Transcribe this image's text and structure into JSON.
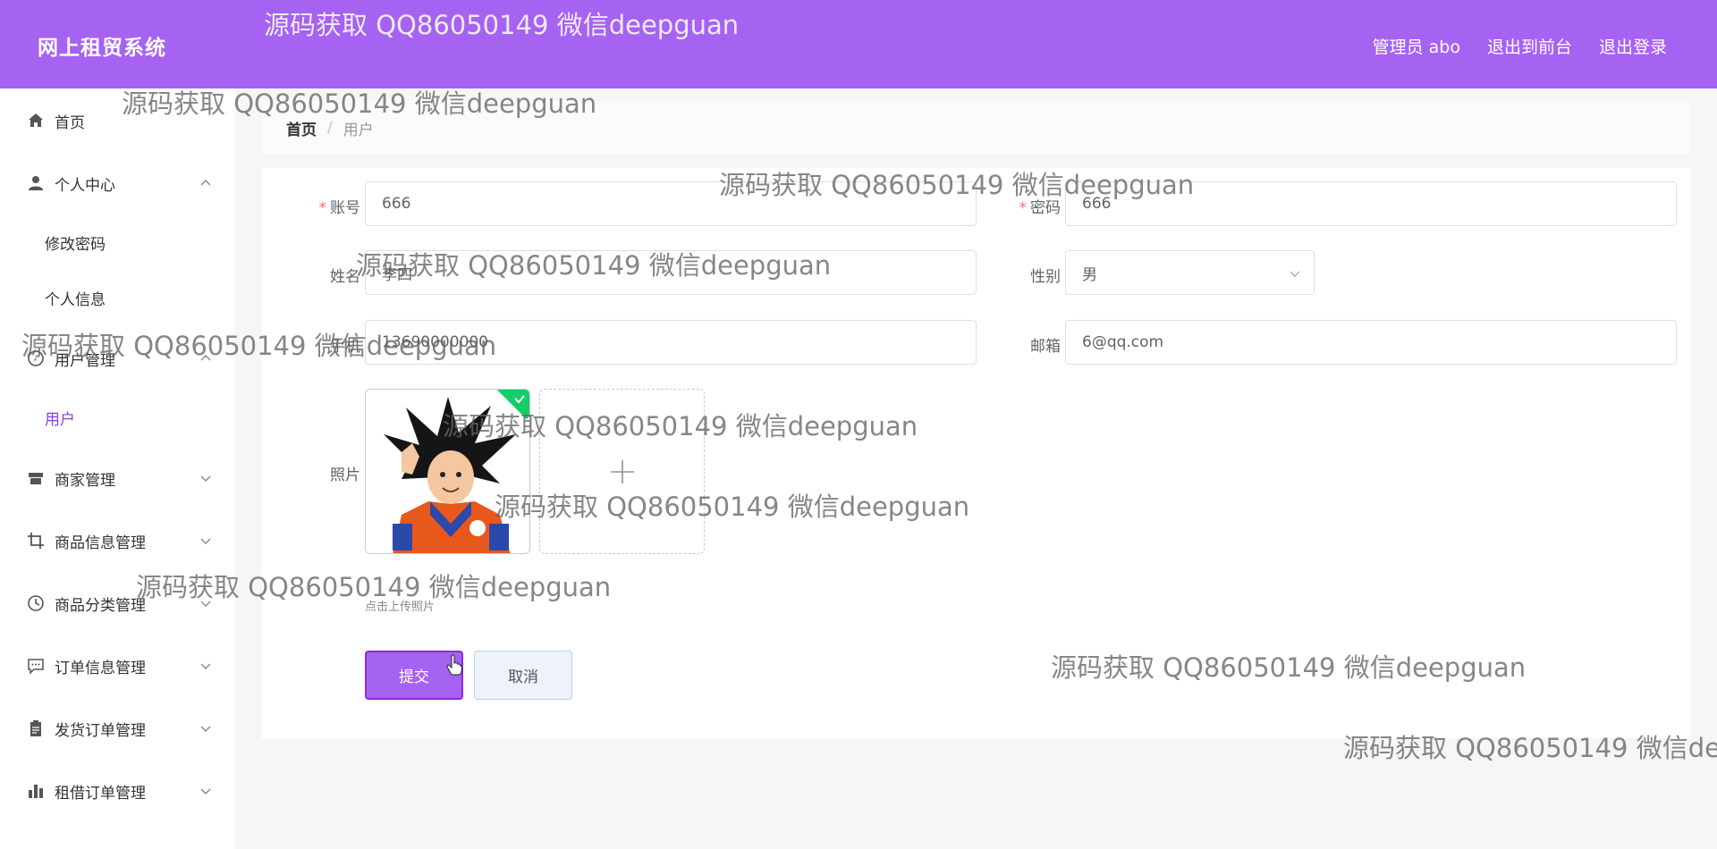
{
  "header": {
    "brand": "网上租贸系统",
    "links": [
      "管理员 abo",
      "退出到前台",
      "退出登录"
    ]
  },
  "sidebar": {
    "home": "首页",
    "personal_center": "个人中心",
    "change_password": "修改密码",
    "personal_info": "个人信息",
    "user_mgmt": "用户管理",
    "user": "用户",
    "merchant_mgmt": "商家管理",
    "product_info_mgmt": "商品信息管理",
    "category_mgmt": "商品分类管理",
    "order_info_mgmt": "订单信息管理",
    "shipping_order_mgmt": "发货订单管理",
    "rental_order_mgmt": "租借订单管理"
  },
  "breadcrumb": {
    "home": "首页",
    "sep": "/",
    "current": "用户"
  },
  "form": {
    "account_label": "账号",
    "account_value": "666",
    "password_label": "密码",
    "password_value": "666",
    "name_label": "姓名",
    "name_value": "李四",
    "gender_label": "性别",
    "gender_value": "男",
    "phone_label": "手机",
    "phone_value": "13690000000",
    "email_label": "邮箱",
    "email_value": "6@qq.com",
    "photo_label": "照片",
    "upload_tip": "点击上传照片",
    "submit": "提交",
    "cancel": "取消"
  },
  "watermark": "源码获取 QQ86050149 微信deepguan",
  "colors": {
    "accent": "#a662f1",
    "required": "#f56c6c",
    "success": "#13ce66"
  }
}
